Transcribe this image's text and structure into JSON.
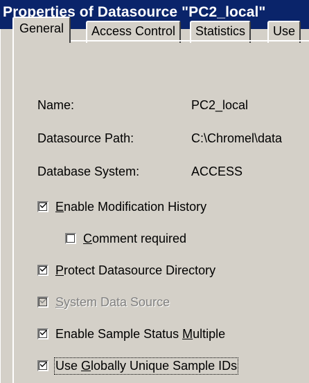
{
  "window": {
    "title": "Properties of Datasource \"PC2_local\""
  },
  "tabs": [
    {
      "label": "General",
      "active": true
    },
    {
      "label": "Access Control",
      "active": false
    },
    {
      "label": "Statistics",
      "active": false
    },
    {
      "label": "Use",
      "active": false
    }
  ],
  "properties": {
    "name_label": "Name:",
    "name_value": "PC2_local",
    "path_label": "Datasource Path:",
    "path_value": "C:\\Chromel\\data",
    "dbsystem_label": "Database System:",
    "dbsystem_value": "ACCESS"
  },
  "options": {
    "modification_history": {
      "pre": "",
      "key": "E",
      "post": "nable Modification History",
      "checked": true,
      "enabled": true
    },
    "comment_required": {
      "pre": "",
      "key": "C",
      "post": "omment required",
      "checked": false,
      "enabled": true
    },
    "protect_directory": {
      "pre": "",
      "key": "P",
      "post": "rotect Datasource Directory",
      "checked": true,
      "enabled": true
    },
    "system_data_source": {
      "pre": "",
      "key": "S",
      "post": "ystem Data Source",
      "checked": true,
      "enabled": false
    },
    "sample_status_multiple": {
      "pre": "Enable Sample Status ",
      "key": "M",
      "post": "ultiple",
      "checked": true,
      "enabled": true
    },
    "unique_sample_ids": {
      "pre": "Use ",
      "key": "G",
      "post": "lobally Unique Sample IDs",
      "checked": true,
      "enabled": true
    }
  },
  "icons": {
    "check": "checkmark-icon"
  }
}
